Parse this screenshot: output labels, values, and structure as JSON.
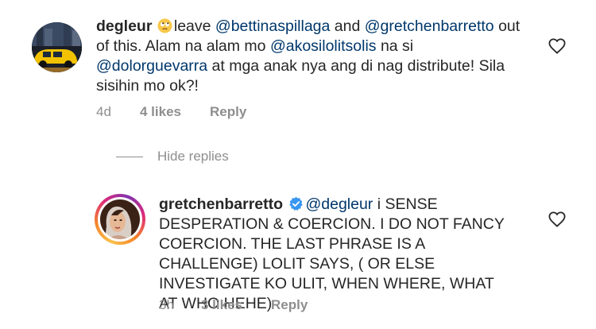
{
  "comments": [
    {
      "username": "degleur",
      "emoji": "rolling-eyes-emoji",
      "segments": [
        {
          "text": "leave ",
          "mention": false
        },
        {
          "text": "@bettinaspillaga",
          "mention": true
        },
        {
          "text": " and ",
          "mention": false
        },
        {
          "text": "@gretchenbarretto",
          "mention": true
        },
        {
          "text": " out of this. Alam na alam mo ",
          "mention": false
        },
        {
          "text": "@akosilolitsolis",
          "mention": true
        },
        {
          "text": " na si ",
          "mention": false
        },
        {
          "text": "@dolorguevarra",
          "mention": true
        },
        {
          "text": " at mga anak nya ang di nag distribute! Sila sisihin mo ok?!",
          "mention": false
        }
      ],
      "time": "4d",
      "likes": "4 likes",
      "reply_label": "Reply"
    },
    {
      "username": "gretchenbarretto",
      "verified": true,
      "segments": [
        {
          "text": "@degleur",
          "mention": true
        },
        {
          "text": "  i SENSE DESPERATION & COERCION. I DO NOT FANCY COERCION. THE LAST PHRASE IS A CHALLENGE) LOLIT SAYS, ( OR ELSE INVESTIGATE KO ULIT, WHEN WHERE, WHAT AT WHO HEHE)",
          "mention": false
        }
      ],
      "time": "3h",
      "likes": "3 likes",
      "reply_label": "Reply"
    }
  ],
  "hide_replies_label": "Hide replies",
  "colors": {
    "text": "#262626",
    "mention": "#00376b",
    "secondary": "#8e8e8e",
    "verified": "#3897f0"
  },
  "icons": [
    "heart-outline-icon",
    "verified-badge-icon",
    "rolling-eyes-emoji"
  ]
}
